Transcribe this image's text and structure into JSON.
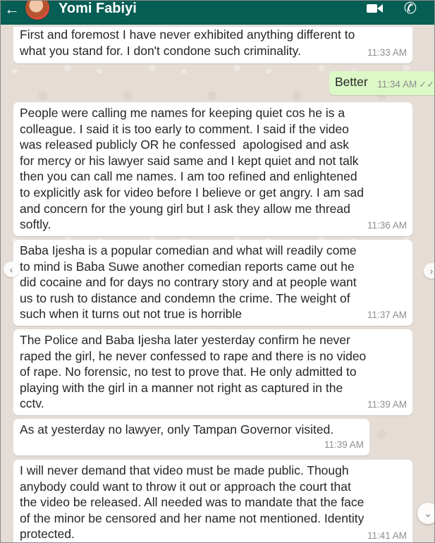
{
  "header": {
    "contact_name": "Yomi Fabiyi",
    "back_icon": "←",
    "video_icon": "video-call-icon",
    "phone_icon": "✆"
  },
  "messages": [
    {
      "text": "First and foremost I have never exhibited anything different to\nwhat you stand for. I don't condone such criminality.",
      "time": "11:33 AM",
      "direction": "in"
    },
    {
      "text": "Better",
      "time": "11:34 AM",
      "direction": "out"
    },
    {
      "text": "People were calling me names for keeping quiet cos he is a\ncolleague. I said it is too early to comment. I said if the video\nwas released publicly OR he confessed  apologised and ask\nfor mercy or his lawyer said same and I kept quiet and not talk\nthen you can call me names. I am too refined and enlightened\nto explicitly ask for video before I believe or get angry. I am sad\nand concern for the young girl but I ask they allow me thread\nsoftly.",
      "time": "11:36 AM",
      "direction": "in"
    },
    {
      "text": "Baba Ijesha is a popular comedian and what will readily come\nto mind is Baba Suwe another comedian reports came out he\ndid cocaine and for days no contrary story and at people want\nus to rush to distance and condemn the crime. The weight of\nsuch when it turns out not true is horrible",
      "time": "11:37 AM",
      "direction": "in"
    },
    {
      "text": "The Police and Baba Ijesha later yesterday confirm he never\nraped the girl, he never confessed to rape and there is no video\nof rape. No forensic, no test to prove that. He only admitted to\nplaying with the girl in a manner not right as captured in the\ncctv.",
      "time": "11:39 AM",
      "direction": "in"
    },
    {
      "text": "As at yesterday no lawyer, only Tampan Governor visited.",
      "time": "11:39 AM",
      "direction": "in"
    },
    {
      "text": "I will never demand that video must be made public. Though\nanybody could want to throw it out or approach the court that\nthe video be released. All needed was to mandate that the face\nof the minor be censored and her name not mentioned. Identity\nprotected.",
      "time": "11:41 AM",
      "direction": "in"
    }
  ],
  "colors": {
    "header": "#075e54",
    "incoming_bubble": "#ffffff",
    "outgoing_bubble": "#dcf8c6",
    "chat_background": "#e5ddd5"
  }
}
